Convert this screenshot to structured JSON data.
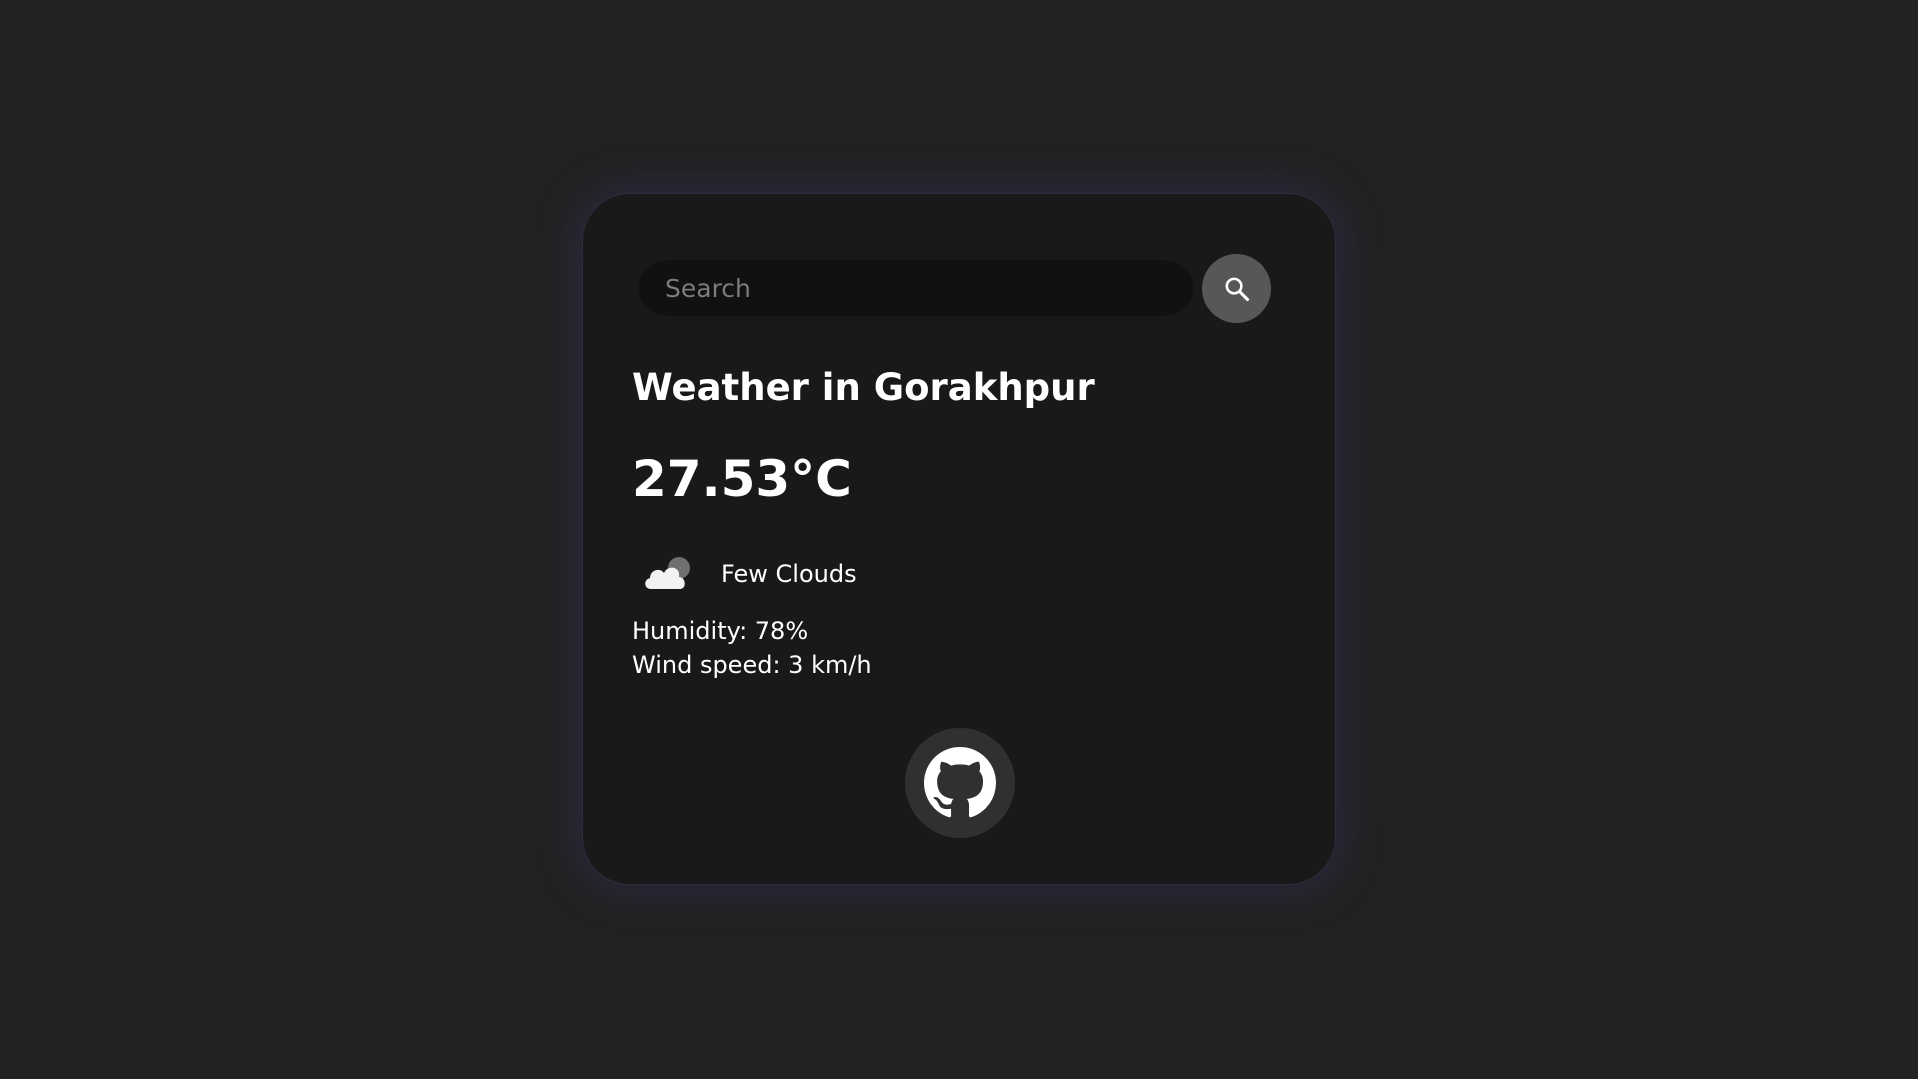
{
  "search": {
    "placeholder": "Search",
    "value": "",
    "button_icon": "search-icon"
  },
  "weather": {
    "city_heading": "Weather in Gorakhpur",
    "temperature": "27.53°C",
    "condition_icon": "few-clouds-icon",
    "description": "Few Clouds",
    "humidity": "Humidity: 78%",
    "wind_speed": "Wind speed: 3 km/h"
  },
  "footer": {
    "github_icon": "github-icon"
  },
  "colors": {
    "page_background": "#222222",
    "card_background": "#191919",
    "card_glow": "#30305a",
    "input_background": "#111111",
    "search_button": "#575757",
    "github_button": "#303030",
    "text": "#ffffff"
  }
}
